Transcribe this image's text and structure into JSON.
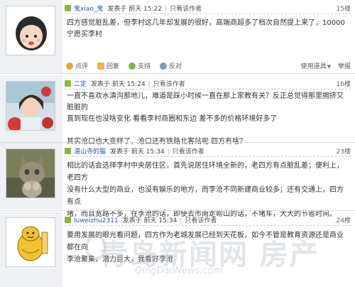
{
  "posts": [
    {
      "username": "鬼xiao_鬼",
      "posted_label": "发表于",
      "date": "前天",
      "time": "15:22",
      "only_author": "只看该作者",
      "floor": "15楼",
      "content": [
        "四方感觉脏乱差，但李村这几年却发展的很好，高端商超多了档次自然提上来了，10000宁愿买李村"
      ]
    },
    {
      "username": "二定",
      "posted_label": "发表于",
      "date": "前天",
      "time": "15:24",
      "only_author": "只看该作者",
      "floor": "16楼",
      "content": [
        "一直不喜欢水清沟那地儿，难道是踩小时候一直在那上家教有关？反正总觉得那里拥挤又脏脏的",
        "直到现在也没啥变化  看看李村商圈和东边  差不多的价格环境好多了",
        "",
        "其实沧口也大变样了，沧口还有铁路北客站呢  四方有啥？"
      ]
    },
    {
      "username": "湛山寺的猫",
      "posted_label": "发表于",
      "date": "前天",
      "time": "15:34",
      "only_author": "只看该作者",
      "floor": "23楼",
      "content": [
        "相比的话会选择李村中央居住区，首先说居住环境全新的，老四方有点脏乱差；便利上，老四方",
        "没有什么大型的商业，也没有娱乐的地方，而李沧不同新建商业较多；还有交通上，四方有点",
        "堵，而且宽路不多，在李沧的话，即使去市南走崂山的话，不堵车，大大的节省时间。"
      ]
    },
    {
      "username": "luweizhu2311",
      "posted_label": "发表于",
      "date": "前天",
      "time": "15:34",
      "only_author": "只看该作者",
      "floor": "24楼",
      "content": [
        "要用发展的眼光看问题，四方作为老城发展已经到天花板，如今不管是教育资源还是商业都在向",
        "李沧聚集，潜力巨大，我看好李沧"
      ]
    }
  ],
  "actions": {
    "comment": "点评",
    "reply": "回复",
    "support": "支持",
    "oppose": "反对",
    "tools": "使用道具",
    "report": "举报"
  },
  "watermark": {
    "main": "青岛新闻网 房产",
    "sub": "QingDaoNews.com"
  }
}
